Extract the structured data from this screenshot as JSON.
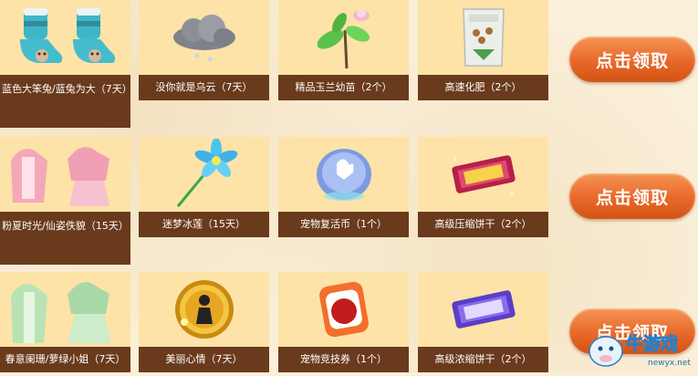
{
  "rows": [
    {
      "items": [
        {
          "label": "蓝色大笨兔/蓝兔为大（7天）",
          "icon": "blue-rabbit-boots-icon"
        },
        {
          "label": "没你就是乌云（7天）",
          "icon": "dark-cloud-icon"
        },
        {
          "label": "精品玉兰幼苗（2个）",
          "icon": "magnolia-sprout-icon"
        },
        {
          "label": "高速化肥（2个）",
          "icon": "fertilizer-bag-icon"
        }
      ],
      "button": "点击领取"
    },
    {
      "items": [
        {
          "label": "粉夏时光/仙姿佚貌（15天）",
          "icon": "pink-summer-outfit-icon"
        },
        {
          "label": "迷梦冰莲（15天）",
          "icon": "ice-lotus-wand-icon"
        },
        {
          "label": "宠物复活币（1个）",
          "icon": "pet-revive-coin-icon"
        },
        {
          "label": "高级压缩饼干（2个）",
          "icon": "compressed-biscuit-icon"
        }
      ],
      "button": "点击领取"
    },
    {
      "items": [
        {
          "label": "春意阑珊/萝绿小姐（7天）",
          "icon": "green-spring-outfit-icon"
        },
        {
          "label": "美丽心情（7天）",
          "icon": "beautiful-mood-badge-icon"
        },
        {
          "label": "宠物竞技券（1个）",
          "icon": "pet-pk-ticket-icon"
        },
        {
          "label": "高级浓缩饼干（2个）",
          "icon": "concentrated-biscuit-icon"
        }
      ],
      "button": "点击领取"
    }
  ],
  "watermark": {
    "logo_text": "牛游戏",
    "url": "newyx.net"
  },
  "colors": {
    "label_bg": "#6a3a1c",
    "item_bg": "#fde3a8",
    "button": "#e8682a"
  }
}
